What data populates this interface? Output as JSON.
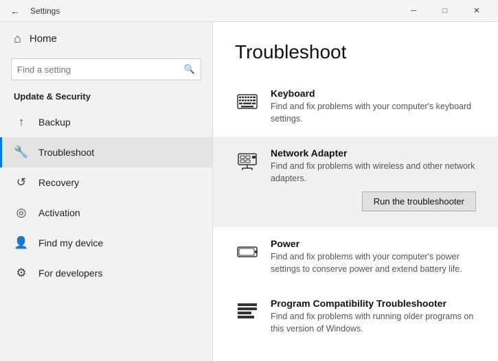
{
  "titlebar": {
    "title": "Settings",
    "back_label": "←",
    "min_label": "─",
    "max_label": "□",
    "close_label": "✕"
  },
  "sidebar": {
    "home_label": "Home",
    "search_placeholder": "Find a setting",
    "section_title": "Update & Security",
    "items": [
      {
        "id": "backup",
        "label": "Backup",
        "icon": "↑"
      },
      {
        "id": "troubleshoot",
        "label": "Troubleshoot",
        "icon": "🔧"
      },
      {
        "id": "recovery",
        "label": "Recovery",
        "icon": "↺"
      },
      {
        "id": "activation",
        "label": "Activation",
        "icon": "✓"
      },
      {
        "id": "find-my-device",
        "label": "Find my device",
        "icon": "👤"
      },
      {
        "id": "for-developers",
        "label": "For developers",
        "icon": "⚙"
      }
    ]
  },
  "main": {
    "page_title": "Troubleshoot",
    "items": [
      {
        "id": "keyboard",
        "title": "Keyboard",
        "desc": "Find and fix problems with your computer's keyboard settings.",
        "highlighted": false
      },
      {
        "id": "network-adapter",
        "title": "Network Adapter",
        "desc": "Find and fix problems with wireless and other network adapters.",
        "highlighted": true,
        "show_button": true,
        "button_label": "Run the troubleshooter"
      },
      {
        "id": "power",
        "title": "Power",
        "desc": "Find and fix problems with your computer's power settings to conserve power and extend battery life.",
        "highlighted": false
      },
      {
        "id": "program-compatibility",
        "title": "Program Compatibility Troubleshooter",
        "desc": "Find and fix problems with running older programs on this version of Windows.",
        "highlighted": false
      }
    ]
  }
}
